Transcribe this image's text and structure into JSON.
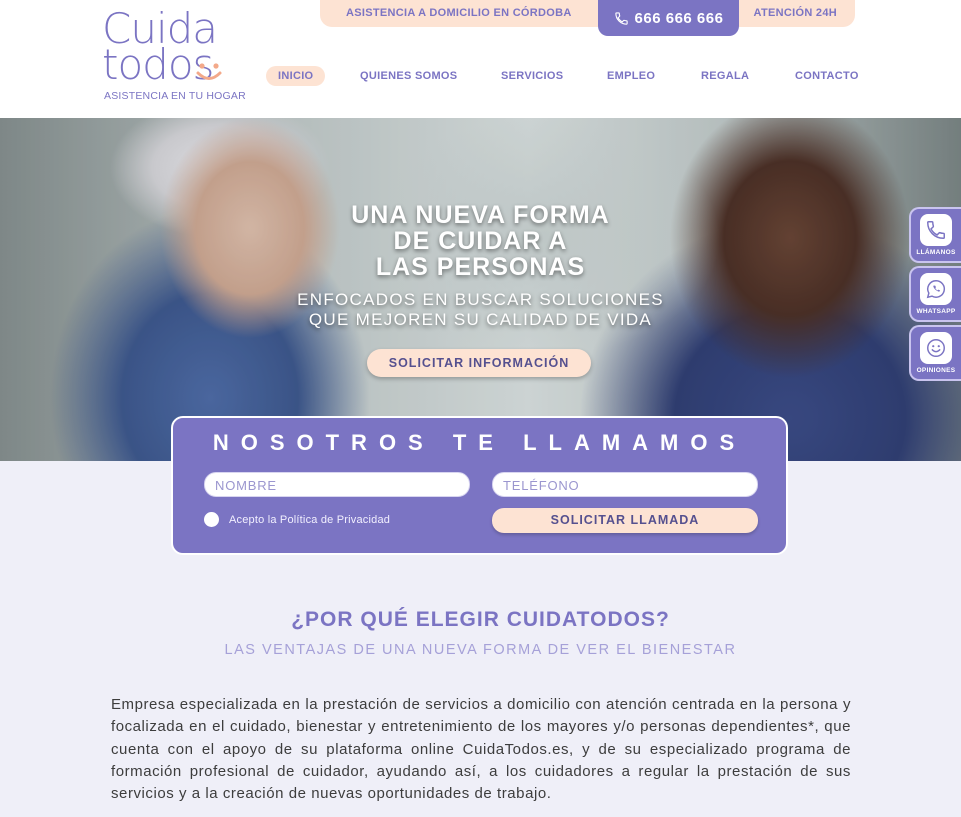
{
  "header": {
    "logo": {
      "line1": "Cuida",
      "line2": "todos",
      "tagline": "ASISTENCIA EN TU HOGAR"
    },
    "topbar": {
      "left_text": "ASISTENCIA A DOMICILIO EN CÓRDOBA",
      "phone": "666 666 666",
      "right_text": "ATENCIÓN 24H"
    },
    "nav": [
      "INICIO",
      "QUIENES SOMOS",
      "SERVICIOS",
      "EMPLEO",
      "REGALA",
      "CONTACTO"
    ]
  },
  "hero": {
    "title_lines": [
      "UNA NUEVA FORMA",
      "DE CUIDAR A",
      "LAS PERSONAS"
    ],
    "subtitle_lines": [
      "ENFOCADOS EN BUSCAR SOLUCIONES",
      "QUE MEJOREN SU CALIDAD DE VIDA"
    ],
    "cta": "SOLICITAR INFORMACIÓN"
  },
  "side_buttons": [
    {
      "label": "LLÁMANOS",
      "icon": "phone-icon"
    },
    {
      "label": "WHATSAPP",
      "icon": "whatsapp-icon"
    },
    {
      "label": "OPINIONES",
      "icon": "smiley-icon"
    }
  ],
  "callback_form": {
    "title": "NOSOTROS TE LLAMAMOS",
    "name_placeholder": "NOMBRE",
    "phone_placeholder": "TELÉFONO",
    "privacy_label": "Acepto la Política de Privacidad",
    "submit": "SOLICITAR LLAMADA"
  },
  "why": {
    "title": "¿POR QUÉ ELEGIR CUIDATODOS?",
    "subtitle": "LAS VENTAJAS DE UNA NUEVA FORMA DE VER EL BIENESTAR",
    "body": "Empresa especializada en la prestación de servicios a domicilio con atención centrada en la persona y focalizada en el cuidado, bienestar y entretenimiento de los mayores y/o personas dependientes*, que cuenta con el apoyo de su plataforma online CuidaTodos.es, y de su especializado programa de formación profesional de cuidador, ayudando así, a los cuidadores a regular la prestación de sus servicios y a la creación de nuevas oportunidades de trabajo."
  },
  "colors": {
    "brand": "#7b74c3",
    "accent_peach": "#fde3d3",
    "page_bg": "#efeff8"
  }
}
